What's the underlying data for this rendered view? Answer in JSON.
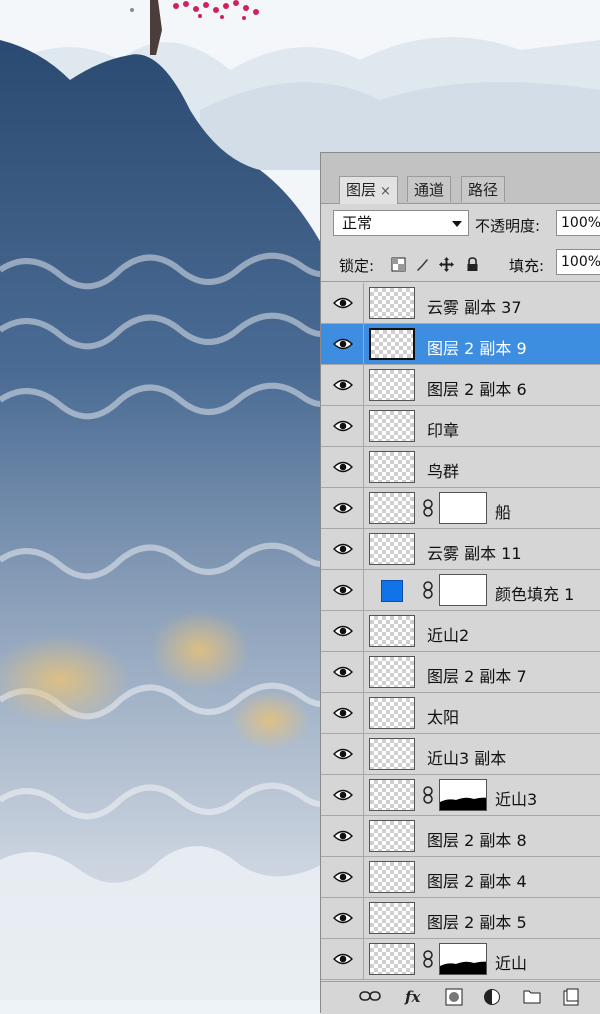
{
  "panel": {
    "tabs": [
      {
        "label": "图层",
        "close": "×"
      },
      {
        "label": "通道"
      },
      {
        "label": "路径"
      }
    ],
    "blend_mode": "正常",
    "opacity_label": "不透明度:",
    "opacity_value": "100%",
    "lock_label": "锁定:",
    "fill_label": "填充:",
    "fill_value": "100%",
    "lock_icons": [
      "lock-transparent-icon",
      "lock-paint-icon",
      "lock-move-icon",
      "lock-all-icon"
    ],
    "bottom_icons": [
      "link-layers-icon",
      "fx-icon",
      "add-mask-icon",
      "adjustment-layer-icon",
      "new-group-icon",
      "new-layer-icon"
    ],
    "fx_label": "fx",
    "selection_color": "#3d8ee0",
    "fill_swatch_color": "#1173e8"
  },
  "layers": [
    {
      "name": "云雾 副本 37",
      "visible": true,
      "thumb": "checker"
    },
    {
      "name": "图层 2 副本 9",
      "visible": true,
      "thumb": "checker",
      "selected": true
    },
    {
      "name": "图层 2 副本 6",
      "visible": true,
      "thumb": "checker"
    },
    {
      "name": "印章",
      "visible": true,
      "thumb": "checker"
    },
    {
      "name": "鸟群",
      "visible": true,
      "thumb": "checker"
    },
    {
      "name": "船",
      "visible": true,
      "thumb": "checker",
      "mask": "white"
    },
    {
      "name": "云雾 副本 11",
      "visible": true,
      "thumb": "checker"
    },
    {
      "name": "颜色填充 1",
      "visible": true,
      "thumb": "color-fill",
      "mask": "white"
    },
    {
      "name": "近山2",
      "visible": true,
      "thumb": "checker"
    },
    {
      "name": "图层 2 副本 7",
      "visible": true,
      "thumb": "checker"
    },
    {
      "name": "太阳",
      "visible": true,
      "thumb": "checker"
    },
    {
      "name": "近山3 副本",
      "visible": true,
      "thumb": "checker"
    },
    {
      "name": "近山3",
      "visible": true,
      "thumb": "checker",
      "mask": "mountain"
    },
    {
      "name": "图层 2 副本 8",
      "visible": true,
      "thumb": "checker"
    },
    {
      "name": "图层 2 副本 4",
      "visible": true,
      "thumb": "checker"
    },
    {
      "name": "图层 2 副本 5",
      "visible": true,
      "thumb": "checker"
    },
    {
      "name": "近山",
      "visible": true,
      "thumb": "checker",
      "mask": "mountain"
    }
  ]
}
